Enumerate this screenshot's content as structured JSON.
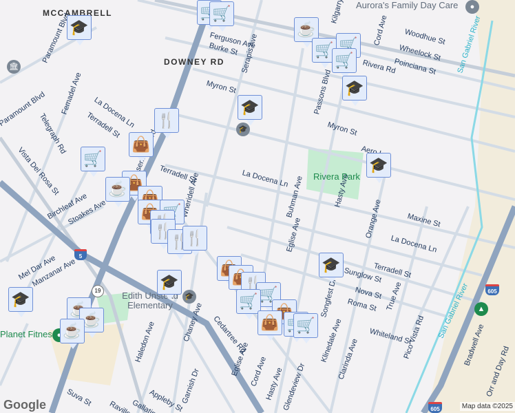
{
  "areas": [
    "MCCAMBRELL",
    "DOWNEY RD"
  ],
  "streets": [
    "Ferguson Ave",
    "Burke St",
    "Myron St",
    "Serapis Ave",
    "Kilgarry Ave",
    "Cord Ave",
    "Woodhue St",
    "Wheelock St",
    "Poinciana St",
    "Rivera Rd",
    "Passons Blvd",
    "Myron St",
    "Aero Ln",
    "La Docena Ln",
    "Buhman Ave",
    "Eglise Ave",
    "Hasty Ave",
    "Orange Ave",
    "Maxine St",
    "La Docena Ln",
    "Terradell St",
    "Sunglow St",
    "Nova St",
    "Roma St",
    "True Ave",
    "Whiteland St",
    "Pico Vista Rd",
    "Klinedale Ave",
    "Clarinda Ave",
    "Songfest Dr",
    "Bradwell Ave",
    "Orr and Day Rd",
    "Paramount Blvd",
    "Paramount Blvd",
    "Telegraph Rd",
    "Femadel Ave",
    "La Docena Ln",
    "Terradell St",
    "Terradell St",
    "Rosemead Blvd",
    "Vista Del Rosa St",
    "Birchleaf Ave",
    "Stoakes Ave",
    "Mel Dar Ave",
    "Manzanar Ave",
    "Haledon Ave",
    "Chaney Ave",
    "Cedartree Rd",
    "Eglise Ave",
    "Cord Ave",
    "Hasty Ave",
    "Appleby St",
    "Gallatin Rd",
    "Garnish Dr",
    "Suva St",
    "Raviller Dr",
    "Wheridell Ave",
    "Glendeview Dr"
  ],
  "places": {
    "daycare": "Aurora's Family Day Care",
    "park": "Rivera Park",
    "school": "Edith Unstead Elementary",
    "gym": "Planet Fitness",
    "river1": "San Gabriel River",
    "river2": "San Gabriel River"
  },
  "shields": {
    "i5": "5",
    "sr19": "19",
    "i605a": "605",
    "i605b": "605"
  },
  "markers": [
    "school-icon",
    "cart-icon",
    "cart-icon",
    "coffee-icon",
    "cart-icon",
    "cart-icon",
    "cart-icon",
    "school-icon",
    "school-icon",
    "school-icon",
    "dining-icon",
    "shopping-bag-icon",
    "cart-icon",
    "shopping-bag-icon",
    "coffee-icon",
    "shopping-bag-icon",
    "shopping-bag-icon",
    "cart-icon",
    "dining-icon",
    "dining-icon",
    "dining-icon",
    "dining-icon",
    "school-icon",
    "school-icon",
    "school-icon",
    "shopping-bag-icon",
    "shopping-bag-icon",
    "dining-icon",
    "cart-icon",
    "cart-icon",
    "shopping-bag-icon",
    "shopping-bag-icon",
    "cart-icon",
    "cart-icon",
    "coffee-icon",
    "coffee-icon",
    "coffee-icon"
  ],
  "footer": {
    "logo": "Google",
    "attribution": "Map data ©2025"
  }
}
